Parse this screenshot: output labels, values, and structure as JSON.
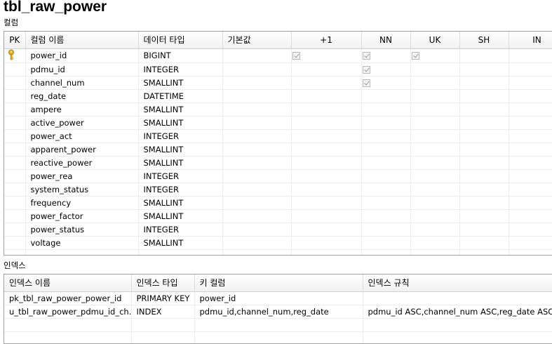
{
  "table_name": "tbl_raw_power",
  "columns_section_label": "컬럼",
  "indexes_section_label": "인덱스",
  "columns_grid": {
    "headers": {
      "pk": "PK",
      "name": "컬럼 이름",
      "type": "데이터 타입",
      "default": "기본값",
      "auto_inc": "+1",
      "nn": "NN",
      "uk": "UK",
      "sh": "SH",
      "in": "IN"
    },
    "rows": [
      {
        "pk": true,
        "name": "power_id",
        "type": "BIGINT",
        "default": "",
        "auto_inc": true,
        "nn": true,
        "uk": true
      },
      {
        "pk": false,
        "name": "pdmu_id",
        "type": "INTEGER",
        "default": "",
        "auto_inc": false,
        "nn": true,
        "uk": false
      },
      {
        "pk": false,
        "name": "channel_num",
        "type": "SMALLINT",
        "default": "",
        "auto_inc": false,
        "nn": true,
        "uk": false
      },
      {
        "pk": false,
        "name": "reg_date",
        "type": "DATETIME",
        "default": "",
        "auto_inc": false,
        "nn": false,
        "uk": false
      },
      {
        "pk": false,
        "name": "ampere",
        "type": "SMALLINT",
        "default": "",
        "auto_inc": false,
        "nn": false,
        "uk": false
      },
      {
        "pk": false,
        "name": "active_power",
        "type": "SMALLINT",
        "default": "",
        "auto_inc": false,
        "nn": false,
        "uk": false
      },
      {
        "pk": false,
        "name": "power_act",
        "type": "INTEGER",
        "default": "",
        "auto_inc": false,
        "nn": false,
        "uk": false
      },
      {
        "pk": false,
        "name": "apparent_power",
        "type": "SMALLINT",
        "default": "",
        "auto_inc": false,
        "nn": false,
        "uk": false
      },
      {
        "pk": false,
        "name": "reactive_power",
        "type": "SMALLINT",
        "default": "",
        "auto_inc": false,
        "nn": false,
        "uk": false
      },
      {
        "pk": false,
        "name": "power_rea",
        "type": "INTEGER",
        "default": "",
        "auto_inc": false,
        "nn": false,
        "uk": false
      },
      {
        "pk": false,
        "name": "system_status",
        "type": "INTEGER",
        "default": "",
        "auto_inc": false,
        "nn": false,
        "uk": false
      },
      {
        "pk": false,
        "name": "frequency",
        "type": "SMALLINT",
        "default": "",
        "auto_inc": false,
        "nn": false,
        "uk": false
      },
      {
        "pk": false,
        "name": "power_factor",
        "type": "SMALLINT",
        "default": "",
        "auto_inc": false,
        "nn": false,
        "uk": false
      },
      {
        "pk": false,
        "name": "power_status",
        "type": "INTEGER",
        "default": "",
        "auto_inc": false,
        "nn": false,
        "uk": false
      },
      {
        "pk": false,
        "name": "voltage",
        "type": "SMALLINT",
        "default": "",
        "auto_inc": false,
        "nn": false,
        "uk": false
      }
    ]
  },
  "index_grid": {
    "headers": {
      "name": "인덱스 이름",
      "type": "인덱스 타입",
      "key_columns": "키 컬럼",
      "rule": "인덱스 규칙"
    },
    "rows": [
      {
        "name": "pk_tbl_raw_power_power_id",
        "type": "PRIMARY KEY",
        "key_columns": "power_id",
        "rule": ""
      },
      {
        "name": "u_tbl_raw_power_pdmu_id_ch...",
        "type": "INDEX",
        "key_columns": "pdmu_id,channel_num,reg_date",
        "rule": "pdmu_id ASC,channel_num ASC,reg_date ASC"
      }
    ]
  },
  "colors": {
    "key_icon": "#e0b020",
    "checkbox_border": "#b8b8b8"
  }
}
